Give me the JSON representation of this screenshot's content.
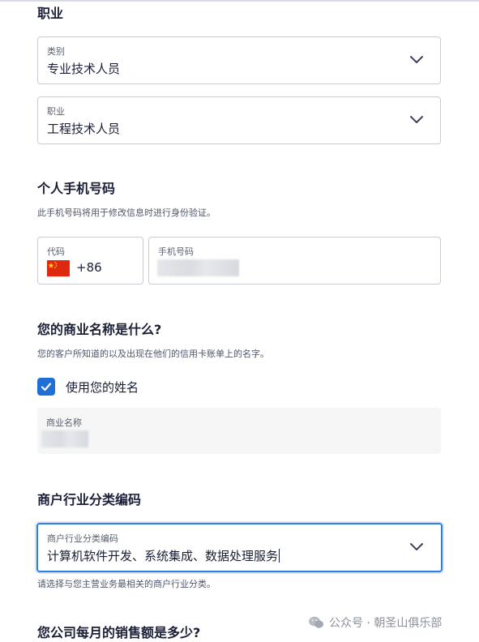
{
  "occupation": {
    "heading": "职业",
    "category": {
      "label": "类别",
      "value": "专业技术人员"
    },
    "job": {
      "label": "职业",
      "value": "工程技术人员"
    }
  },
  "phone": {
    "heading": "个人手机号码",
    "description": "此手机号码将用于修改信息时进行身份验证。",
    "code": {
      "label": "代码",
      "value": "+86",
      "flag": "china-flag"
    },
    "number": {
      "label": "手机号码"
    }
  },
  "business_name": {
    "heading": "您的商业名称是什么?",
    "description": "您的客户所知道的以及出现在他们的信用卡账单上的名字。",
    "use_name_checkbox": {
      "label": "使用您的姓名",
      "checked": true
    },
    "name_field": {
      "label": "商业名称"
    }
  },
  "mcc": {
    "heading": "商户行业分类编码",
    "field": {
      "label": "商户行业分类编码",
      "value": "计算机软件开发、系统集成、数据处理服务"
    },
    "help": "请选择与您主营业务最相关的商户行业分类。"
  },
  "monthly_sales": {
    "heading": "您公司每月的销售额是多少?"
  },
  "watermark": {
    "text": "公众号 · 朝圣山俱乐部",
    "icon": "wechat-icon"
  },
  "colors": {
    "accent": "#1f6fd6",
    "focus_border": "#2f7fe0",
    "text": "#1a1f36",
    "muted": "#4f566b"
  }
}
